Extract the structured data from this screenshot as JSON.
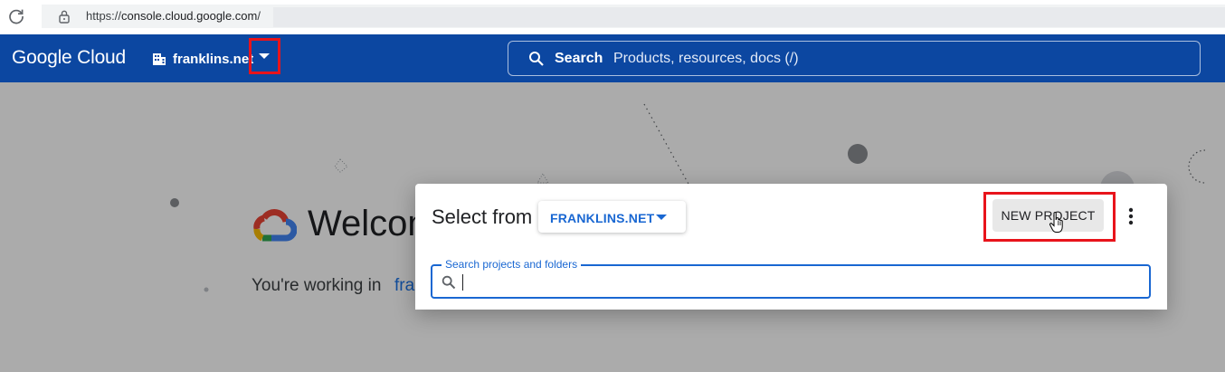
{
  "browser": {
    "url_scheme": "https://",
    "url_host": "console.cloud.google.com",
    "url_suffix": "/"
  },
  "header": {
    "logo_text": "Google Cloud",
    "org_name": "franklins.net",
    "search_label": "Search",
    "search_placeholder": "Products, resources, docs (/)",
    "brand_color": "#0c47a1"
  },
  "page": {
    "welcome_title": "Welcome",
    "working_text": "You're working in",
    "working_link": "franklins.net"
  },
  "modal": {
    "title": "Select from",
    "org_selector_label": "FRANKLINS.NET",
    "new_project_label": "NEW PROJECT",
    "search_field_label": "Search projects and folders",
    "search_value": ""
  },
  "annotation": {
    "highlight_color": "#e8141b"
  },
  "icons": [
    "reload-icon",
    "lock-icon",
    "building-icon",
    "chevron-down-icon",
    "search-icon",
    "google-cloud-logo-icon",
    "more-vert-icon",
    "hand-pointer-icon"
  ]
}
